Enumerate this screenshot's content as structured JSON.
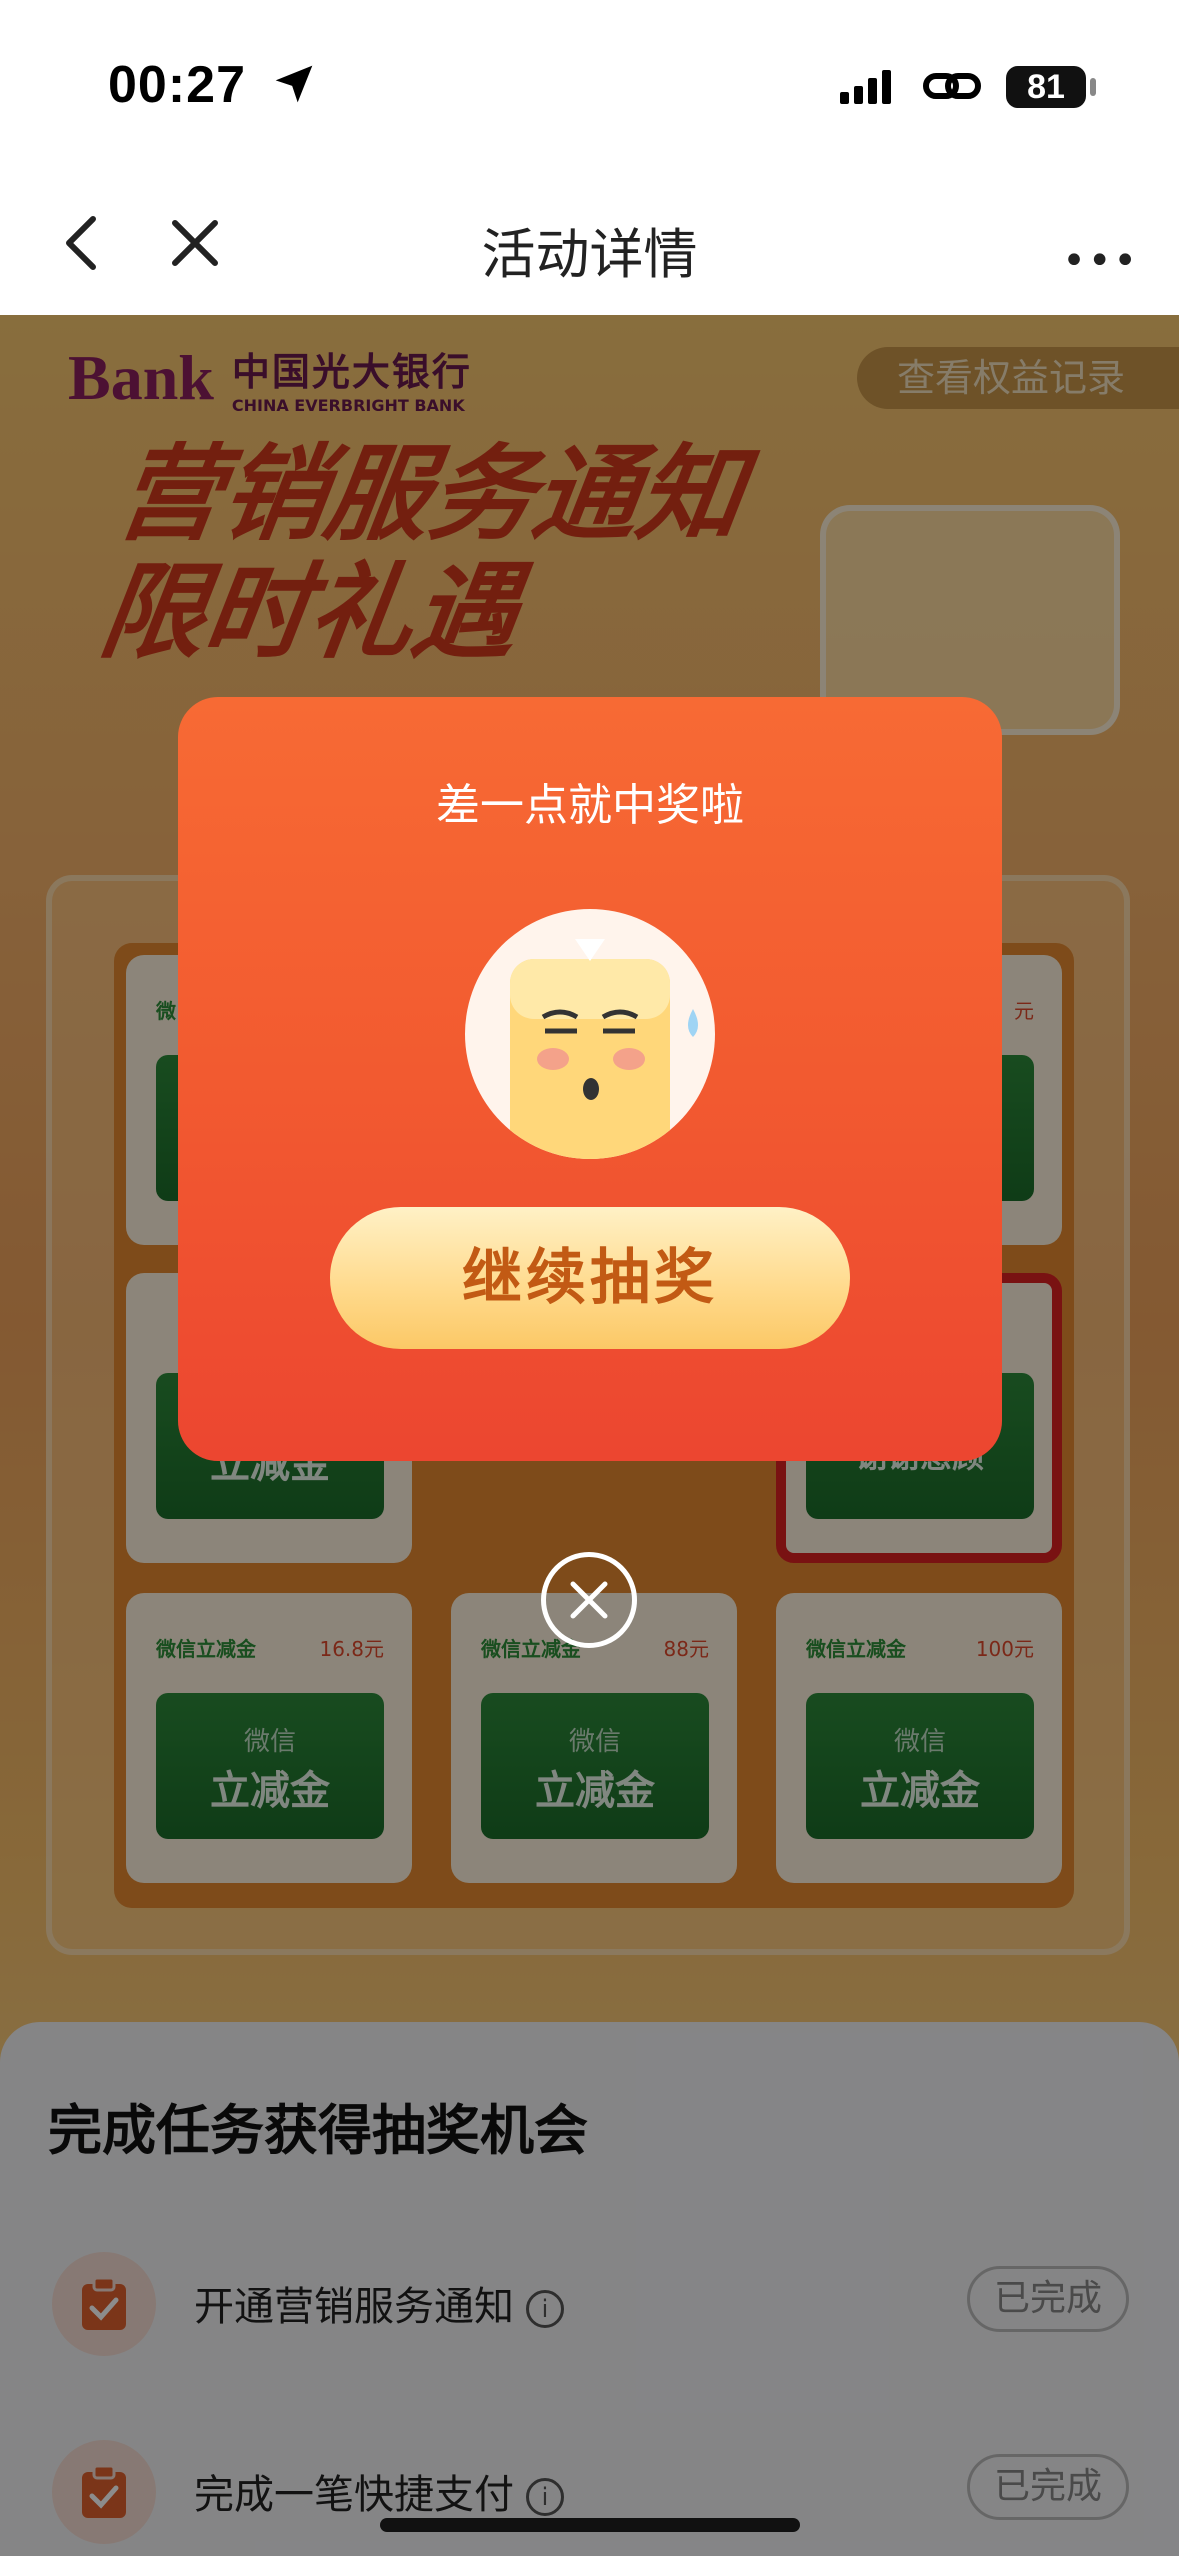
{
  "status_bar": {
    "time": "00:27",
    "battery": "81"
  },
  "nav": {
    "title": "活动详情",
    "more": "•••"
  },
  "banner": {
    "bank_cn": "中国光大银行",
    "bank_en": "CHINA EVERBRIGHT BANK",
    "bank_logo_text": "Bank",
    "records_button": "查看权益记录",
    "title_line1": "营销服务通知",
    "title_line2": "限时礼遇"
  },
  "prizes": [
    {
      "name": "微信立减金",
      "value": "16.8元",
      "coupon_top": "微信",
      "coupon_main": "立减金"
    },
    {
      "name": "微信立减金",
      "value": "88元",
      "coupon_top": "微信",
      "coupon_main": "立减金"
    },
    {
      "name": "微信立减金",
      "value": "100元",
      "coupon_top": "微信",
      "coupon_main": "立减金"
    }
  ],
  "partial_prizes": {
    "left_mid": "立减金",
    "right_mid": "谢谢惠顾",
    "top_left_name": "微",
    "top_right_value": "元"
  },
  "modal": {
    "title": "差一点就中奖啦",
    "button": "继续抽奖"
  },
  "tasks": {
    "heading": "完成任务获得抽奖机会",
    "items": [
      {
        "label": "开通营销服务通知",
        "status": "已完成"
      },
      {
        "label": "完成一笔快捷支付",
        "status": "已完成"
      }
    ],
    "info": "i"
  }
}
